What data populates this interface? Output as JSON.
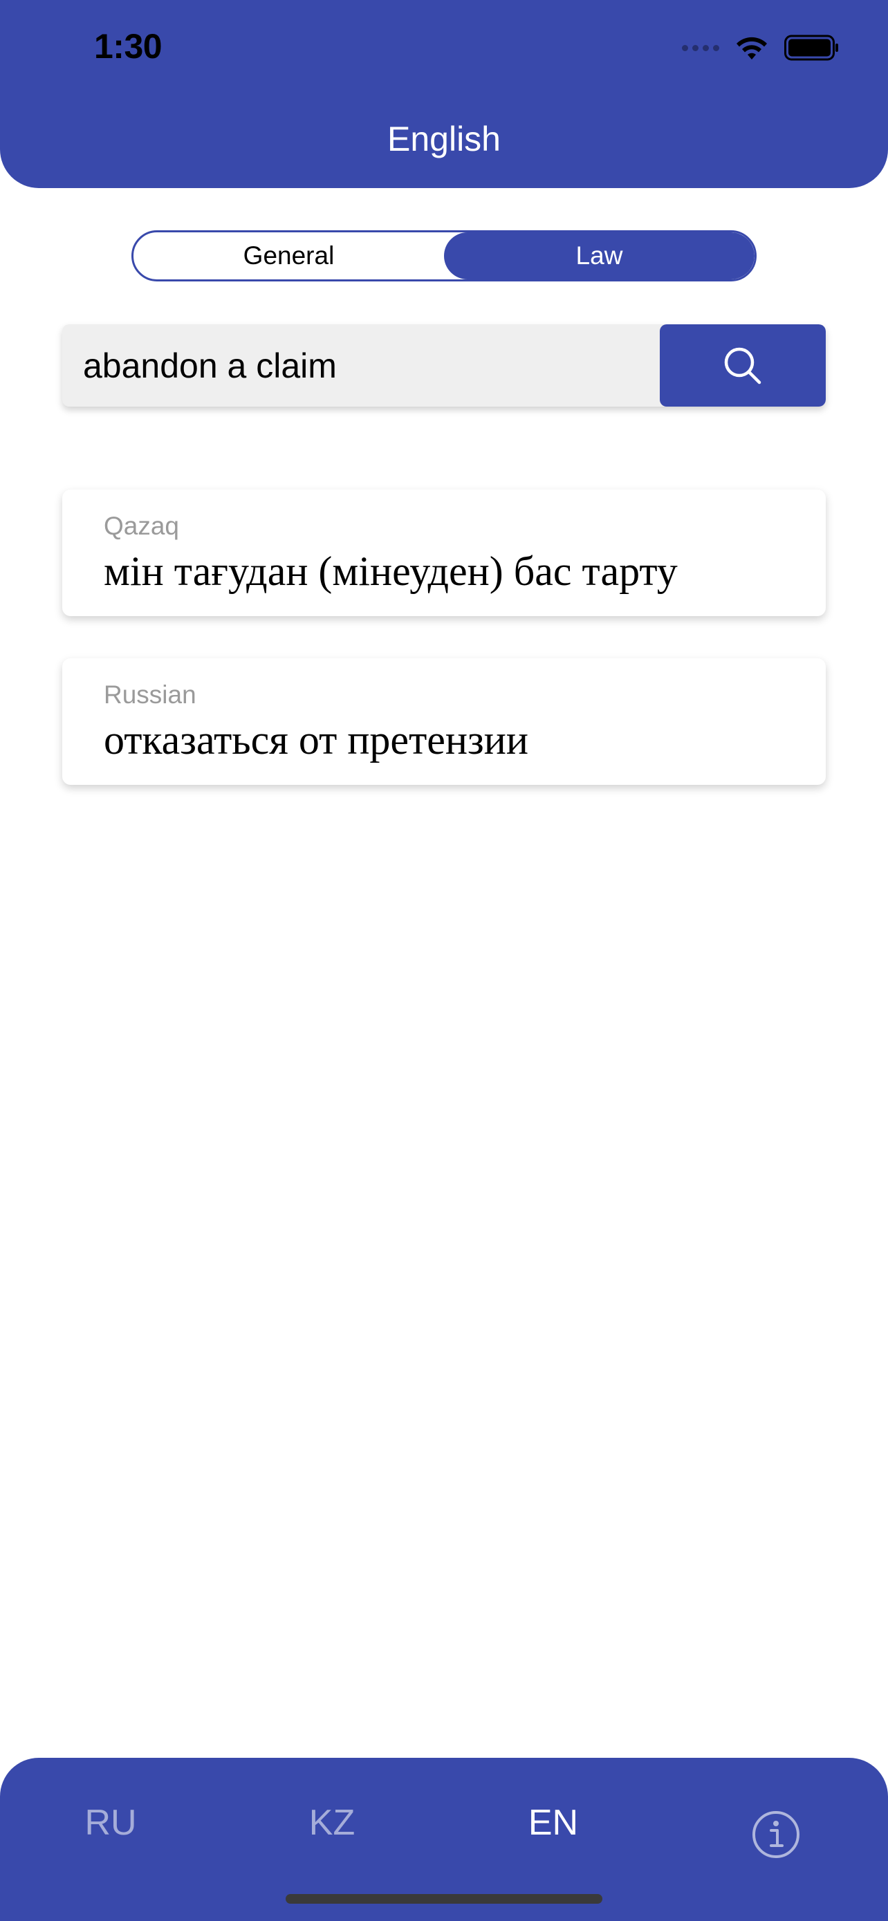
{
  "status_bar": {
    "time": "1:30"
  },
  "header": {
    "title": "English"
  },
  "segment": {
    "options": [
      "General",
      "Law"
    ],
    "selected": "Law"
  },
  "search": {
    "value": "abandon a claim",
    "placeholder": "",
    "button_icon": "search-icon"
  },
  "results": [
    {
      "language": "Qazaq",
      "translation": "мін тағудан (мінеуден) бас тарту"
    },
    {
      "language": "Russian",
      "translation": "отказаться от претензии"
    }
  ],
  "tabbar": {
    "tabs": [
      "RU",
      "KZ",
      "EN"
    ],
    "active": "EN",
    "info_icon": "info-icon"
  },
  "colors": {
    "accent": "#3949AB",
    "search_bg": "#EFEFEF",
    "label_gray": "#9A9A9A"
  }
}
